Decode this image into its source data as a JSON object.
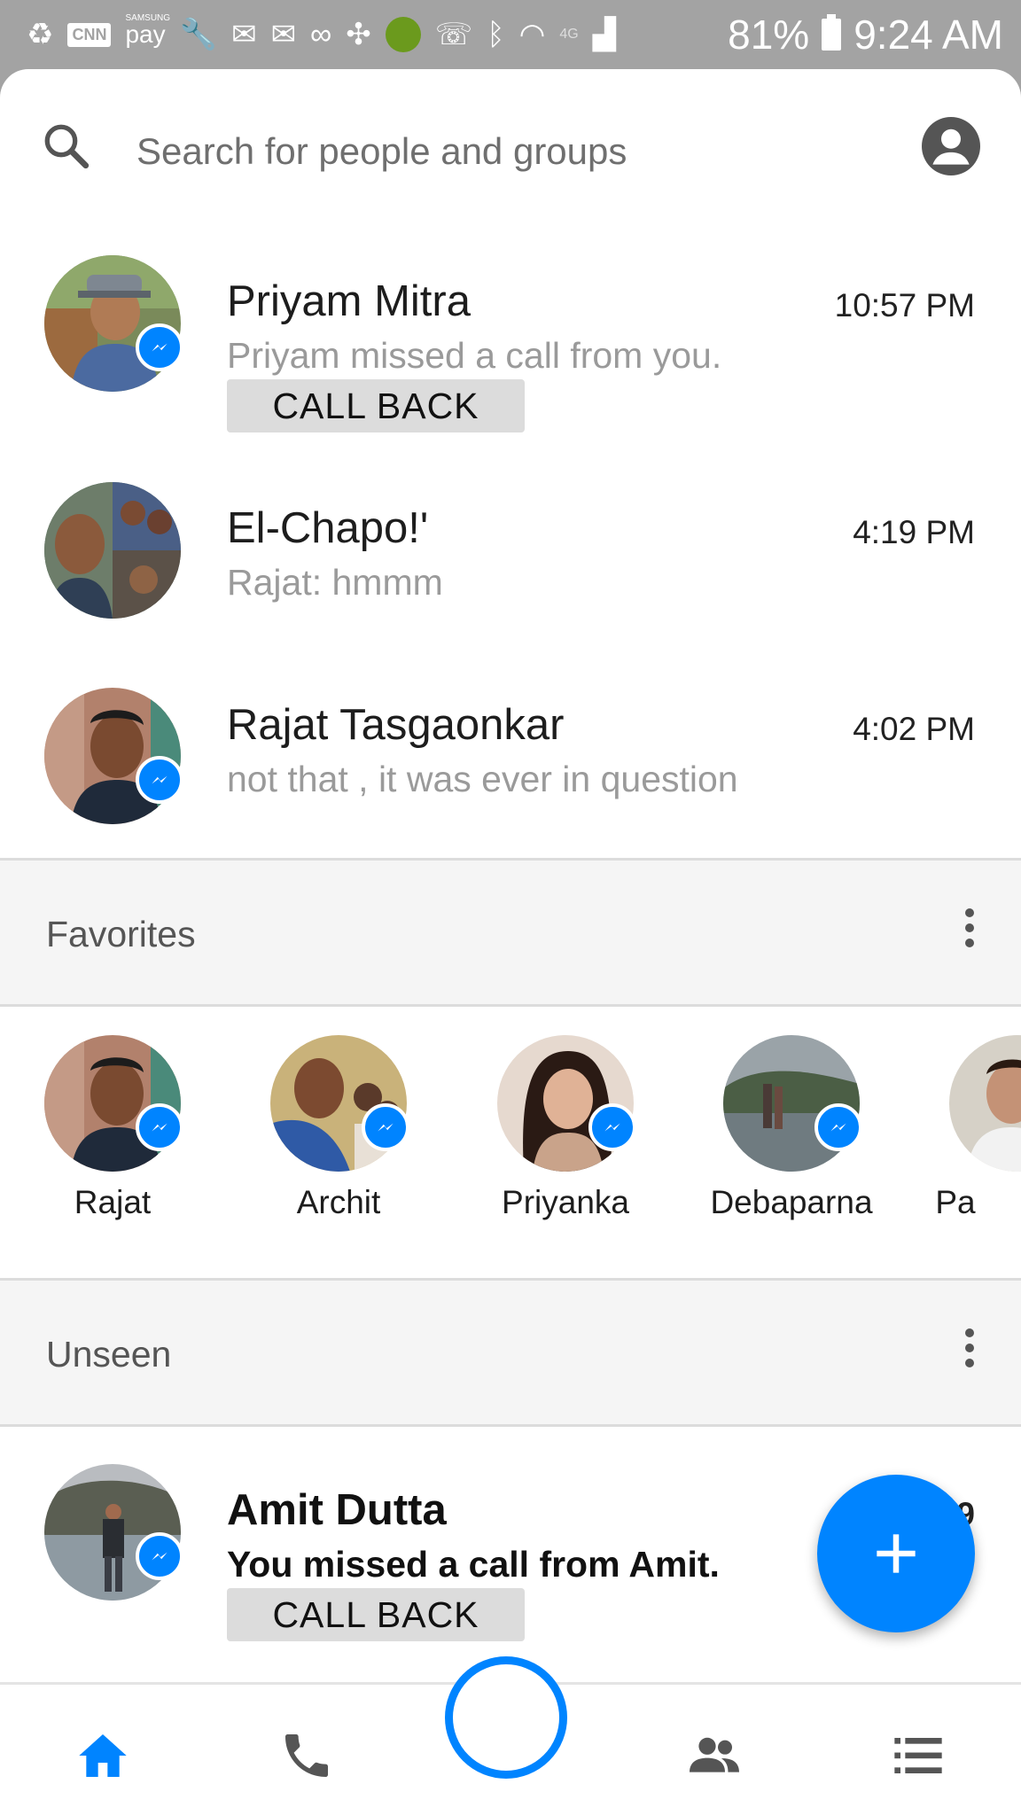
{
  "status_bar": {
    "battery": "81%",
    "time": "9:24 AM",
    "carrier_badge": "CNN",
    "pay_label": "pay",
    "pay_brand": "SAMSUNG",
    "network": "4G"
  },
  "search": {
    "placeholder": "Search for people and groups"
  },
  "threads": [
    {
      "name": "Priyam Mitra",
      "snippet": "Priyam missed a call from you.",
      "time": "10:57 PM",
      "action": "CALL BACK",
      "messenger_badge": true
    },
    {
      "name": "El-Chapo!'",
      "snippet": "Rajat: hmmm",
      "time": "4:19 PM",
      "messenger_badge": false
    },
    {
      "name": "Rajat Tasgaonkar",
      "snippet": "not that , it was ever in question",
      "time": "4:02 PM",
      "messenger_badge": true
    }
  ],
  "favorites": {
    "title": "Favorites",
    "items": [
      {
        "name": "Rajat"
      },
      {
        "name": "Archit"
      },
      {
        "name": "Priyanka"
      },
      {
        "name": "Debaparna"
      },
      {
        "name": "Pa"
      }
    ]
  },
  "unseen": {
    "title": "Unseen",
    "threads": [
      {
        "name": "Amit Dutta",
        "snippet": "You missed a call from Amit.",
        "time": "9",
        "action": "CALL BACK",
        "messenger_badge": true
      }
    ]
  },
  "colors": {
    "accent": "#0084ff",
    "status_bar": "#a3a3a3",
    "section_bg": "#f5f5f5"
  },
  "bottom_nav": [
    "home-icon",
    "phone-icon",
    "camera-button",
    "people-icon",
    "list-icon"
  ]
}
